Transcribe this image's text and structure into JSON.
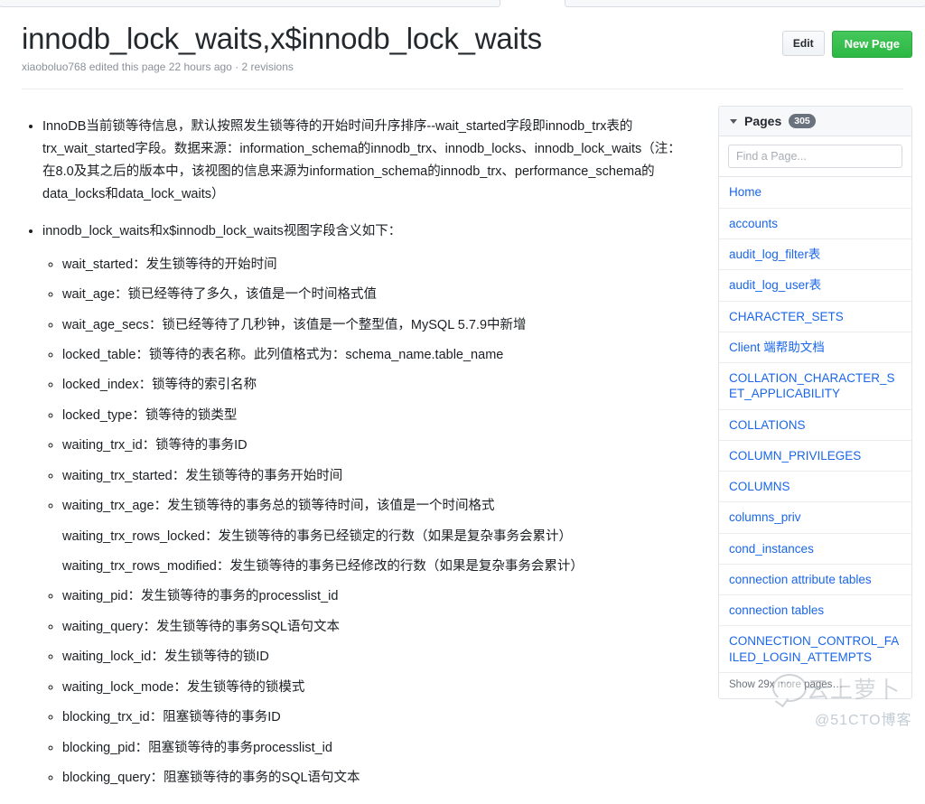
{
  "header": {
    "title": "innodb_lock_waits,x$innodb_lock_waits",
    "byline": "xiaoboluo768 edited this page 22 hours ago · 2 revisions",
    "edit_label": "Edit",
    "new_page_label": "New Page"
  },
  "content": {
    "bullets": [
      "InnoDB当前锁等待信息，默认按照发生锁等待的开始时间升序排序--wait_started字段即innodb_trx表的trx_wait_started字段。数据来源：information_schema的innodb_trx、innodb_locks、innodb_lock_waits（注：在8.0及其之后的版本中，该视图的信息来源为information_schema的innodb_trx、performance_schema的data_locks和data_lock_waits）",
      "innodb_lock_waits和x$innodb_lock_waits视图字段含义如下："
    ],
    "fields": [
      "wait_started：发生锁等待的开始时间",
      "wait_age：锁已经等待了多久，该值是一个时间格式值",
      "wait_age_secs：锁已经等待了几秒钟，该值是一个整型值，MySQL 5.7.9中新增",
      "locked_table：锁等待的表名称。此列值格式为：schema_name.table_name",
      "locked_index：锁等待的索引名称",
      "locked_type：锁等待的锁类型",
      "waiting_trx_id：锁等待的事务ID",
      "waiting_trx_started：发生锁等待的事务开始时间",
      "waiting_trx_age：发生锁等待的事务总的锁等待时间，该值是一个时间格式",
      "waiting_trx_rows_locked：发生锁等待的事务已经锁定的行数（如果是复杂事务会累计）",
      "waiting_trx_rows_modified：发生锁等待的事务已经修改的行数（如果是复杂事务会累计）",
      "waiting_pid：发生锁等待的事务的processlist_id",
      "waiting_query：发生锁等待的事务SQL语句文本",
      "waiting_lock_id：发生锁等待的锁ID",
      "waiting_lock_mode：发生锁等待的锁模式",
      "blocking_trx_id：阻塞锁等待的事务ID",
      "blocking_pid：阻塞锁等待的事务processlist_id",
      "blocking_query：阻塞锁等待的事务的SQL语句文本"
    ]
  },
  "sidebar": {
    "title": "Pages",
    "count": "305",
    "search_placeholder": "Find a Page...",
    "pages": [
      "Home",
      "accounts",
      "audit_log_filter表",
      "audit_log_user表",
      "CHARACTER_SETS",
      "Client 端帮助文档",
      "COLLATION_CHARACTER_SET_APPLICABILITY",
      "COLLATIONS",
      "COLUMN_PRIVILEGES",
      "COLUMNS",
      "columns_priv",
      "cond_instances",
      "connection attribute tables",
      "connection tables",
      "CONNECTION_CONTROL_FAILED_LOGIN_ATTEMPTS"
    ],
    "footer": "Show 29x more pages…"
  },
  "watermark": {
    "brand": "云上萝卜",
    "site": "@51CTO博客"
  },
  "colors": {
    "link": "#1a66e8",
    "primary_button": "#2cb844",
    "badge": "#6a737d"
  }
}
